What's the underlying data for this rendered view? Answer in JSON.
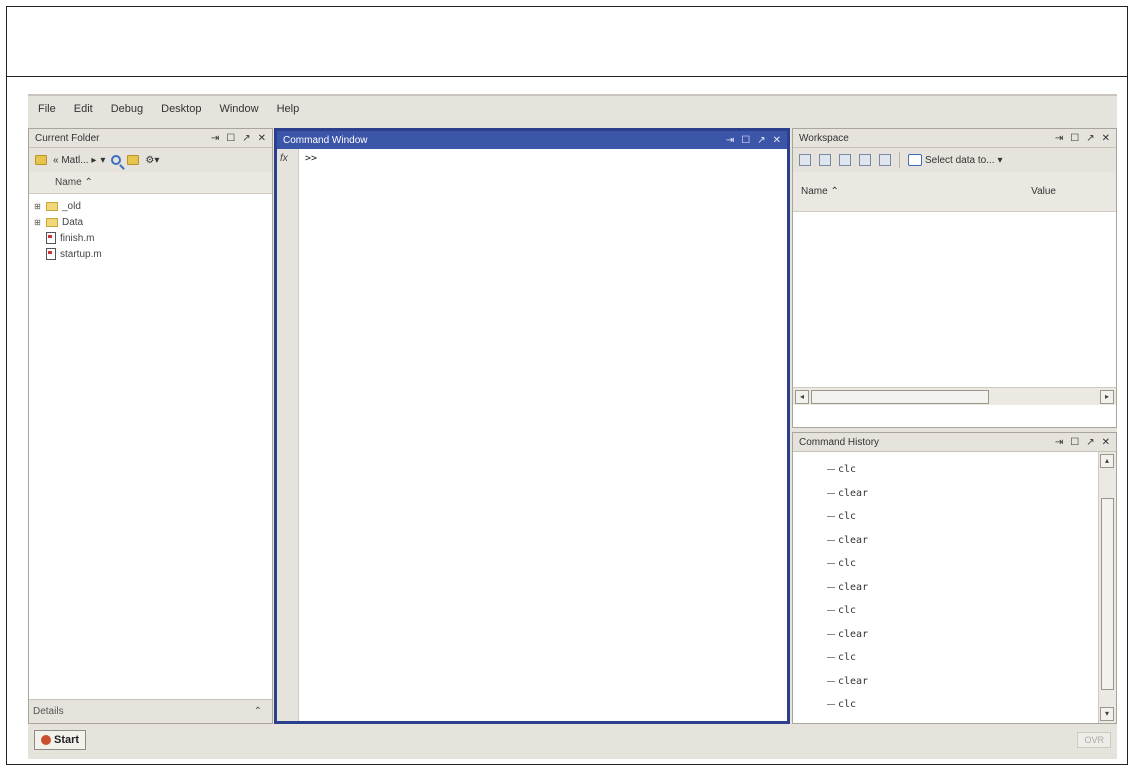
{
  "menu": [
    "File",
    "Edit",
    "Debug",
    "Desktop",
    "Window",
    "Help"
  ],
  "window_controls": {
    "undock": "⇥",
    "maximize": "☐",
    "pin": "↗",
    "close": "✕"
  },
  "current_folder": {
    "title": "Current Folder",
    "path": "« Matl... ▸",
    "column_name": "Name ⌃",
    "items": [
      {
        "type": "folder",
        "name": "_old",
        "expander": "⊞"
      },
      {
        "type": "folder",
        "name": "Data",
        "expander": "⊞"
      },
      {
        "type": "file",
        "name": "finish.m"
      },
      {
        "type": "file",
        "name": "startup.m"
      }
    ],
    "details_label": "Details",
    "details_chevron": "⌃"
  },
  "command_window": {
    "title": "Command Window",
    "fx": "fx",
    "prompt": ">>"
  },
  "workspace": {
    "title": "Workspace",
    "select_data": "Select data to...",
    "col_name": "Name ⌃",
    "col_value": "Value"
  },
  "command_history": {
    "title": "Command History",
    "entries": [
      "clc",
      "clear",
      "clc",
      "clear",
      "clc",
      "clear",
      "clc",
      "clear",
      "clc",
      "clear",
      "clc"
    ]
  },
  "statusbar": {
    "start": "Start",
    "ovr": "OVR"
  }
}
